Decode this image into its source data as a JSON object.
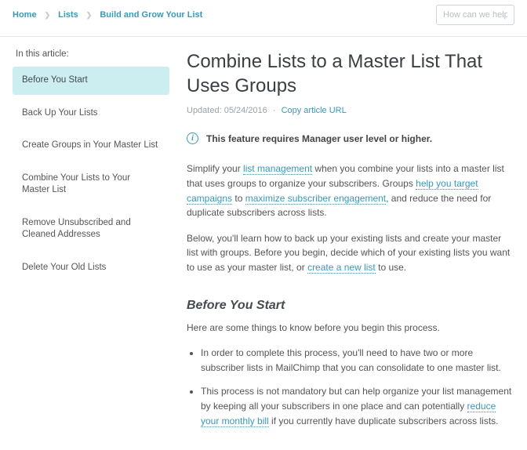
{
  "breadcrumb": {
    "home": "Home",
    "lists": "Lists",
    "current": "Build and Grow Your List"
  },
  "search": {
    "placeholder": "How can we help?"
  },
  "sidebar": {
    "title": "In this article:",
    "items": [
      {
        "label": "Before You Start"
      },
      {
        "label": "Back Up Your Lists"
      },
      {
        "label": "Create Groups in Your Master List"
      },
      {
        "label": "Combine Your Lists to Your Master List"
      },
      {
        "label": "Remove Unsubscribed and Cleaned Addresses"
      },
      {
        "label": "Delete Your Old Lists"
      }
    ]
  },
  "article": {
    "title": "Combine Lists to a Master List That Uses Groups",
    "updated_label": "Updated: 05/24/2016",
    "copy_url": "Copy article URL",
    "notice": "This feature requires Manager user level or higher.",
    "p1_a": "Simplify your ",
    "p1_link1": "list management",
    "p1_b": " when you combine your lists into a master list that uses groups to organize your subscribers. Groups ",
    "p1_link2": "help you target campaigns",
    "p1_c": " to ",
    "p1_link3": "maximize subscriber engagement",
    "p1_d": ", and reduce the need for duplicate subscribers across lists.",
    "p2_a": "Below, you'll learn how to back up your existing lists and create your master list with groups. Before you begin, decide which of your existing  lists you want to use as your master list, or ",
    "p2_link1": "create a new list",
    "p2_b": " to use.",
    "section1_title": "Before You Start",
    "section1_intro": "Here are some things to know before you begin this process.",
    "bullet1": "In order to complete this process, you'll need to have two or more subscriber lists in MailChimp that you can consolidate to one master list.",
    "bullet2_a": "This process is not mandatory but can help organize your list management by keeping all your subscribers in one place and can potentially ",
    "bullet2_link": "reduce your monthly bill",
    "bullet2_b": " if you currently have duplicate subscribers across lists."
  }
}
